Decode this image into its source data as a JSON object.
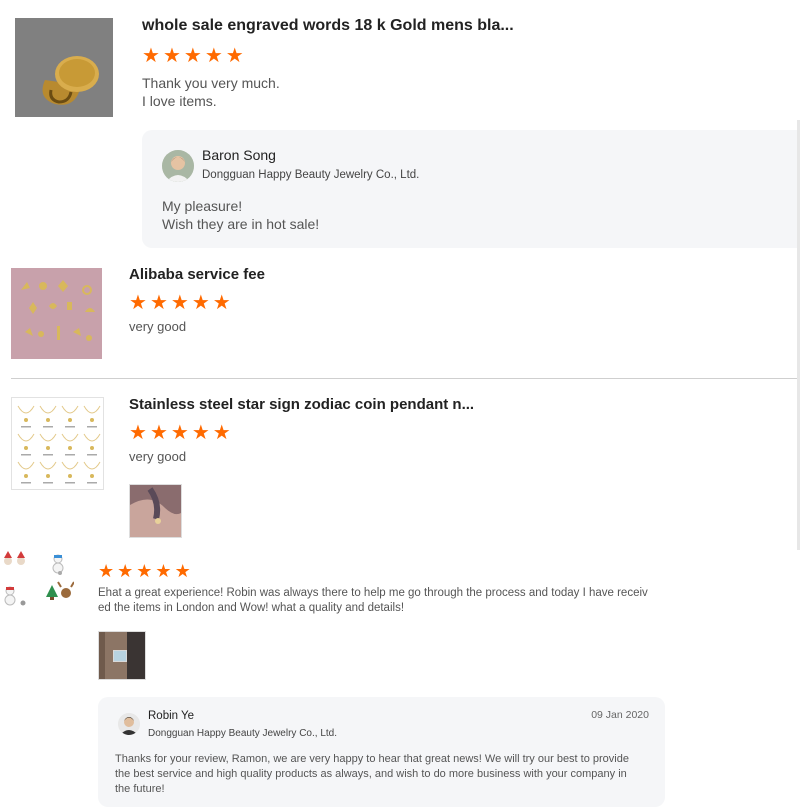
{
  "colors": {
    "star": "#ff6a00",
    "reply_bg": "#f5f6f8",
    "divider": "#cfcfcf"
  },
  "reviews": [
    {
      "product_title": "whole sale engraved words 18 k Gold mens bla...",
      "rating": 5,
      "text": "Thank you very much.\nI love items.",
      "reply": {
        "name": "Baron Song",
        "company": "Dongguan Happy Beauty Jewelry Co., Ltd.",
        "text": "My pleasure!\nWish they are in hot sale!"
      }
    },
    {
      "product_title": "Alibaba service fee",
      "rating": 5,
      "text": "very good"
    },
    {
      "product_title": "Stainless steel star sign zodiac coin pendant n...",
      "rating": 5,
      "text": "very good"
    },
    {
      "rating": 5,
      "text": "Ehat a great experience! Robin was always there to help me go through the process and today I have receiv\ned the items in London and Wow! what a quality and details!",
      "reply": {
        "name": "Robin Ye",
        "company": "Dongguan Happy Beauty Jewelry Co., Ltd.",
        "date": "09 Jan 2020",
        "text": "Thanks for your review, Ramon, we are very happy to hear that great news! We will try our best to provide\nthe best service and high quality products as always, and wish to do more business with your company in\nthe future!"
      }
    }
  ]
}
